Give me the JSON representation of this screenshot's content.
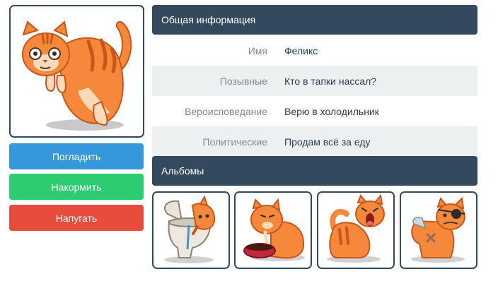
{
  "profile": {
    "avatar_icon": "orange-cat-icon"
  },
  "actions": {
    "pet_label": "Погладить",
    "feed_label": "Накормить",
    "scare_label": "Напугать"
  },
  "info": {
    "title": "Общая информация",
    "rows": [
      {
        "label": "Имя",
        "value": "Феликс"
      },
      {
        "label": "Позывные",
        "value": "Кто в тапки нассал?"
      },
      {
        "label": "Вероисповедание",
        "value": "Верю в холодильник"
      },
      {
        "label": "Политические",
        "value": "Продам всё за еду"
      }
    ]
  },
  "albums": {
    "title": "Альбомы",
    "items": [
      {
        "icon": "cat-toilet-icon"
      },
      {
        "icon": "cat-food-bowl-icon"
      },
      {
        "icon": "cat-yawning-icon"
      },
      {
        "icon": "cat-pirate-icon"
      }
    ]
  },
  "colors": {
    "dark": "#34495e",
    "blue": "#3498db",
    "green": "#2ecc71",
    "red": "#e74c3c",
    "cat_orange": "#f5883a",
    "cat_stripe": "#c8561b"
  }
}
